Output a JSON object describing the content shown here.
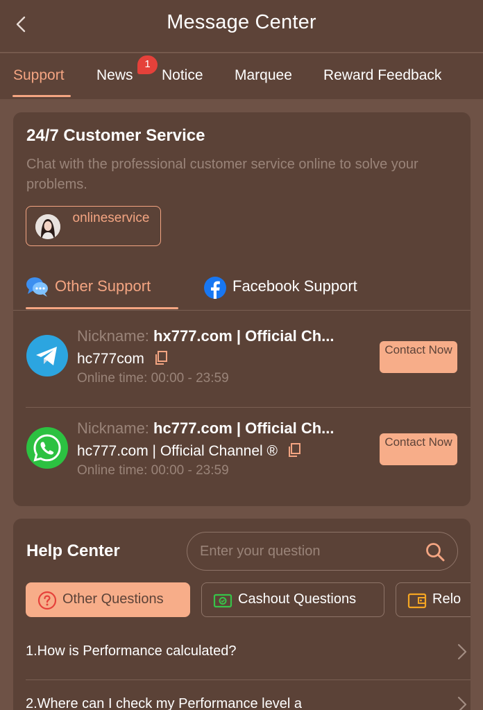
{
  "header": {
    "title": "Message Center",
    "back_icon": "chevron-left-icon"
  },
  "tabs": [
    {
      "label": "Support",
      "active": true
    },
    {
      "label": "News",
      "badge": "1"
    },
    {
      "label": "Notice"
    },
    {
      "label": "Marquee"
    },
    {
      "label": "Reward Feedback"
    }
  ],
  "customer_service": {
    "title": "24/7 Customer Service",
    "description": "Chat with the professional customer service online to solve your problems.",
    "online_button_label": "onlineservice"
  },
  "support_tabs": [
    {
      "label": "Other Support",
      "icon": "chat-bubbles-icon",
      "active": true
    },
    {
      "label": "Facebook Support",
      "icon": "facebook-icon"
    }
  ],
  "contacts": [
    {
      "icon": "telegram-icon",
      "nickname_label": "Nickname:",
      "nickname": "hx777.com | Official Ch...",
      "account": "hc777com",
      "online_time": "Online time: 00:00 - 23:59",
      "button_label": "Contact Now"
    },
    {
      "icon": "whatsapp-icon",
      "nickname_label": "Nickname:",
      "nickname": "hc777.com | Official Ch...",
      "account": "hc777.com | Official Channel ®",
      "online_time": "Online time: 00:00 - 23:59",
      "button_label": "Contact Now"
    }
  ],
  "help_center": {
    "title": "Help Center",
    "search_placeholder": "Enter your question",
    "search_value": "",
    "categories": [
      {
        "label": "Other Questions",
        "icon": "question-circle-icon",
        "active": true
      },
      {
        "label": "Cashout Questions",
        "icon": "cash-icon"
      },
      {
        "label": "Relo",
        "icon": "wallet-icon"
      }
    ],
    "faqs": [
      "1.How is Performance calculated?",
      "2.Where can I check my Performance level a"
    ]
  },
  "colors": {
    "background": "#6e5246",
    "header": "#5d4338",
    "card": "#5b4237",
    "accent": "#f4a582",
    "button": "#f7ad89",
    "badge": "#e5413a",
    "muted_text": "#9a8479"
  }
}
